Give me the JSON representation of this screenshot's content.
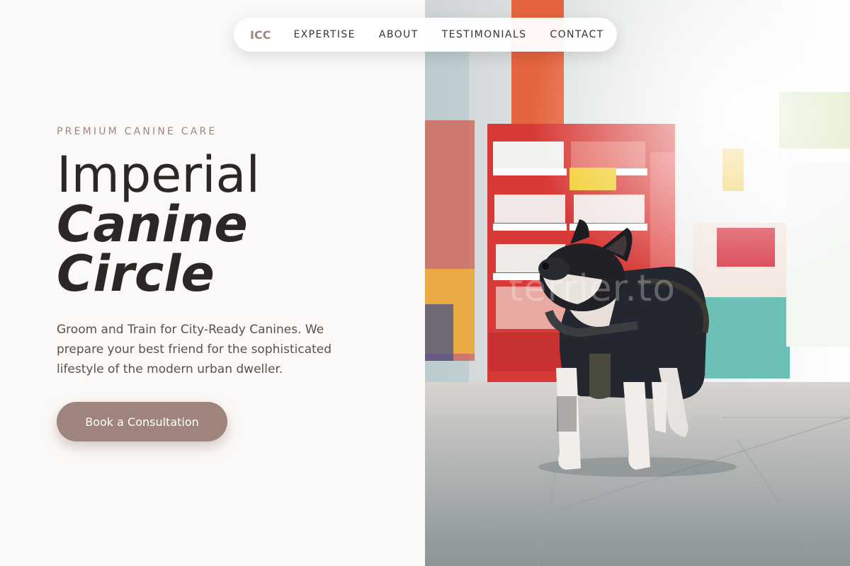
{
  "nav": {
    "logo": "ICC",
    "links": [
      "EXPERTISE",
      "ABOUT",
      "TESTIMONIALS",
      "CONTACT"
    ]
  },
  "hero": {
    "eyebrow": "PREMIUM CANINE CARE",
    "title_line1": "Imperial",
    "title_line2": "Canine",
    "title_line3": "Circle",
    "description": "Groom and Train for City-Ready Canines. We prepare your best friend for the sophisticated lifestyle of the modern urban dweller.",
    "cta_label": "Book a Consultation"
  },
  "photo": {
    "watermark": "terrier.to"
  },
  "colors": {
    "accent": "#9e847a",
    "background": "#fbf9f7",
    "text": "#2b2726"
  }
}
